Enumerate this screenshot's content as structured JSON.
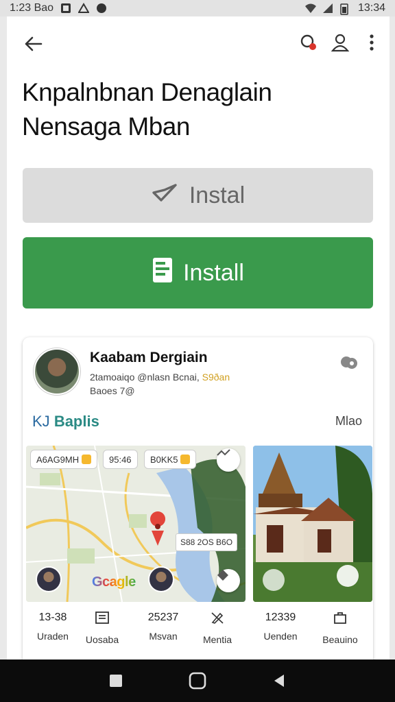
{
  "status_bar": {
    "time": "1:23 Bao",
    "clock": "13:34"
  },
  "title": {
    "line1": "Knpalnbnan Denaglain",
    "line2": "Nensaga Mban"
  },
  "buttons": {
    "secondary_label": "Instal",
    "primary_label": "Install"
  },
  "card": {
    "name": "Kaabam Dergiain",
    "subtitle_prefix": "2tamoaiqo @nlasn Bcnai,",
    "subtitle_highlight": "S9ðan",
    "subtitle2": "Baoes 7@"
  },
  "section": {
    "prefix": "KJ",
    "title": "Baplis",
    "more": "Mlao"
  },
  "map": {
    "chips": [
      "A6AG9MH",
      "95:46",
      "B0KK5"
    ],
    "tag": "S88 2OS B6O",
    "logo": "Gcagle"
  },
  "stats": [
    {
      "value": "13-38",
      "label": "Uraden"
    },
    {
      "value": "",
      "label": "Uosaba"
    },
    {
      "value": "25237",
      "label": "Msvan"
    },
    {
      "value": "",
      "label": "Mentia"
    },
    {
      "value": "12339",
      "label": "Uenden"
    },
    {
      "value": "",
      "label": "Beauino"
    }
  ],
  "colors": {
    "install_green": "#3a9a4c",
    "section_teal": "#2a8a84",
    "highlight": "#d1a021"
  }
}
